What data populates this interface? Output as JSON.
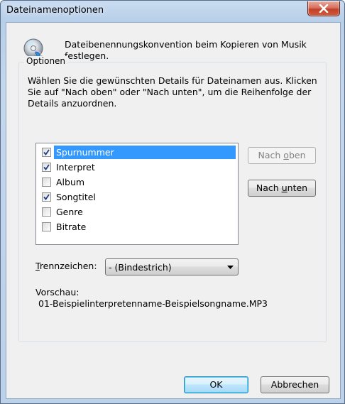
{
  "window": {
    "title": "Dateinamenoptionen",
    "close_label": "X"
  },
  "header": {
    "icon": "cd-copy-icon",
    "text": "Dateibenennungskonvention beim Kopieren von Musik festlegen."
  },
  "options": {
    "legend": "Optionen",
    "description": "Wählen Sie die gewünschten Details für Dateinamen aus. Klicken Sie auf \"Nach oben\" oder \"Nach unten\", um die Reihenfolge der Details anzuordnen.",
    "items": [
      {
        "label": "Spurnummer",
        "checked": true,
        "selected": true
      },
      {
        "label": "Interpret",
        "checked": true,
        "selected": false
      },
      {
        "label": "Album",
        "checked": false,
        "selected": false
      },
      {
        "label": "Songtitel",
        "checked": true,
        "selected": false
      },
      {
        "label": "Genre",
        "checked": false,
        "selected": false
      },
      {
        "label": "Bitrate",
        "checked": false,
        "selected": false
      }
    ],
    "move_up": {
      "pre": "Nach ",
      "accel": "o",
      "post": "ben",
      "enabled": false
    },
    "move_down": {
      "pre": "Nach ",
      "accel": "u",
      "post": "nten",
      "enabled": true
    },
    "separator": {
      "label_accel": "T",
      "label_rest": "rennzeichen:",
      "value": "- (Bindestrich)"
    },
    "preview": {
      "label": "Vorschau:",
      "value": "01-Beispielinterpretenname-Beispielsongname.MP3"
    }
  },
  "footer": {
    "ok": "OK",
    "cancel": "Abbrechen"
  },
  "colors": {
    "selection": "#3399ff",
    "close_button": "#c7452d",
    "dialog_face": "#f0f0f0"
  }
}
